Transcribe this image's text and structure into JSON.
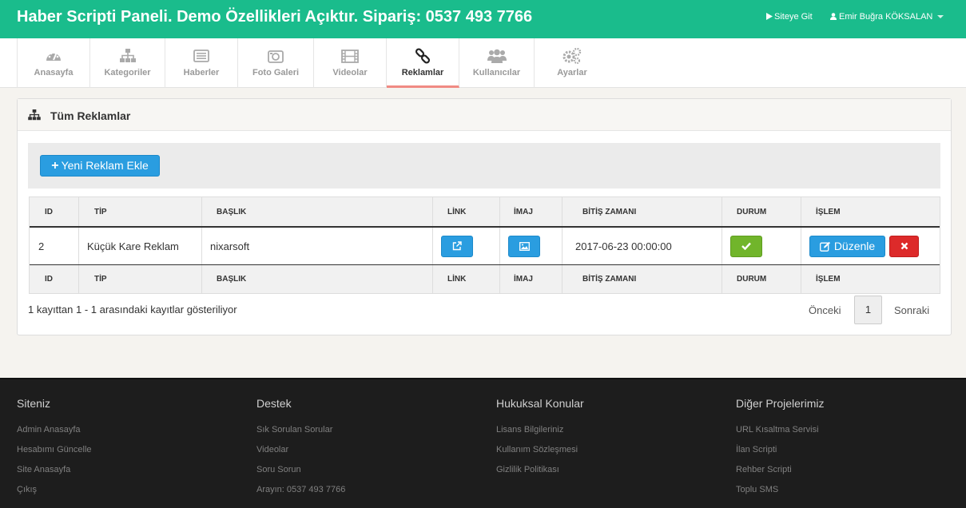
{
  "header": {
    "title": "Haber Scripti Paneli. Demo Özellikleri Açıktır. Sipariş: 0537 493 7766",
    "site_link": "Siteye Git",
    "user": "Emir Buğra KÖKSALAN"
  },
  "nav": {
    "tabs": [
      {
        "label": "Anasayfa",
        "icon": "dashboard-icon"
      },
      {
        "label": "Kategoriler",
        "icon": "sitemap-icon"
      },
      {
        "label": "Haberler",
        "icon": "newspaper-icon"
      },
      {
        "label": "Foto Galeri",
        "icon": "camera-icon"
      },
      {
        "label": "Videolar",
        "icon": "film-icon"
      },
      {
        "label": "Reklamlar",
        "icon": "link-icon",
        "active": true
      },
      {
        "label": "Kullanıcılar",
        "icon": "users-icon"
      },
      {
        "label": "Ayarlar",
        "icon": "cogs-icon"
      }
    ]
  },
  "panel": {
    "title": "Tüm Reklamlar",
    "new_button": "Yeni Reklam Ekle"
  },
  "table": {
    "columns": [
      "ID",
      "TİP",
      "BAŞLIK",
      "LİNK",
      "İMAJ",
      "BİTİŞ ZAMANI",
      "DURUM",
      "İŞLEM"
    ],
    "rows": [
      {
        "id": "2",
        "type": "Küçük Kare Reklam",
        "title": "nixarsoft",
        "end_time": "2017-06-23 00:00:00",
        "edit_label": "Düzenle"
      }
    ]
  },
  "pagination": {
    "info": "1 kayıttan 1 - 1 arasındaki kayıtlar gösteriliyor",
    "prev": "Önceki",
    "page": "1",
    "next": "Sonraki"
  },
  "footer": {
    "columns": [
      {
        "title": "Siteniz",
        "links": [
          "Admin Anasayfa",
          "Hesabımı Güncelle",
          "Site Anasayfa",
          "Çıkış"
        ]
      },
      {
        "title": "Destek",
        "links": [
          "Sık Sorulan Sorular",
          "Videolar",
          "Soru Sorun",
          "Arayın: 0537 493 7766"
        ]
      },
      {
        "title": "Hukuksal Konular",
        "links": [
          "Lisans Bilgileriniz",
          "Kullanım Sözleşmesi",
          "Gizlilik Politikası"
        ]
      },
      {
        "title": "Diğer Projelerimiz",
        "links": [
          "URL Kısaltma Servisi",
          "İlan Scripti",
          "Rehber Scripti",
          "Toplu SMS"
        ]
      }
    ]
  },
  "colors": {
    "header_bg": "#1abc8c",
    "primary": "#2a9de0",
    "success": "#71b52b",
    "danger": "#dd2a2a",
    "active_tab_underline": "#f08a83",
    "footer_bg": "#1d1d1d"
  }
}
